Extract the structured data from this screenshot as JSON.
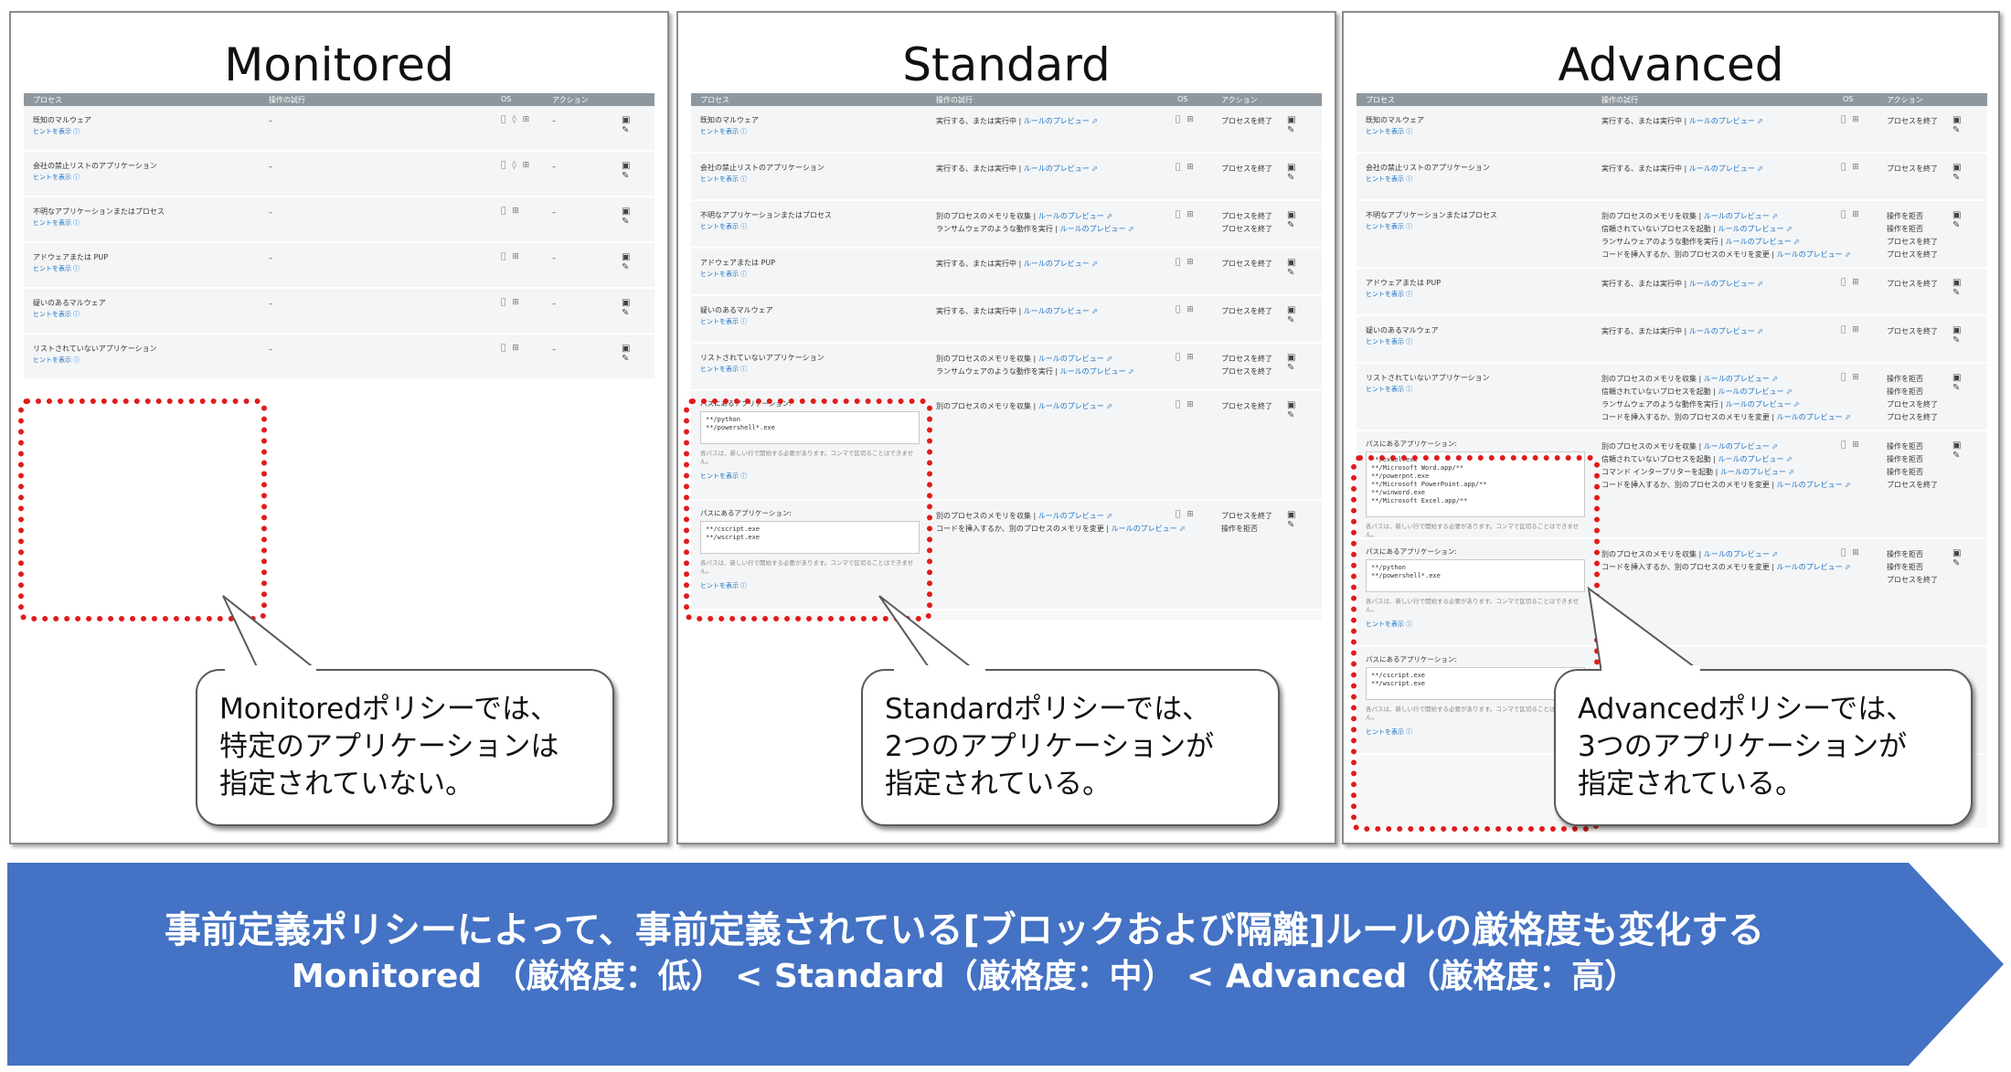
{
  "table_headers": {
    "process": "プロセス",
    "operation": "操作の試行",
    "os": "OS",
    "action": "アクション"
  },
  "hint_label": "ヒントを表示 ⓘ",
  "os_icons": {
    "mac_win_linux": " ◊ ⊞",
    "mac_win": " ⊞"
  },
  "tool_icons": "▣ ✎",
  "rule_preview": "ルールのプレビュー ⬀",
  "monitored": {
    "title": "Monitored",
    "rows": [
      {
        "process": "既知のマルウェア",
        "op": "–",
        "os": "mac_win_linux",
        "act": "–"
      },
      {
        "process": "会社の禁止リストのアプリケーション",
        "op": "–",
        "os": "mac_win_linux",
        "act": "–"
      },
      {
        "process": "不明なアプリケーションまたはプロセス",
        "op": "–",
        "os": "mac_win",
        "act": "–"
      },
      {
        "process": "アドウェアまたは PUP",
        "op": "–",
        "os": "mac_win",
        "act": "–"
      },
      {
        "process": "疑いのあるマルウェア",
        "op": "–",
        "os": "mac_win",
        "act": "–"
      },
      {
        "process": "リストされていないアプリケーション",
        "op": "–",
        "os": "mac_win",
        "act": "–"
      }
    ],
    "callout": [
      "Monitoredポリシーでは、",
      "特定のアプリケーションは",
      "指定されていない。"
    ]
  },
  "standard": {
    "title": "Standard",
    "rows": [
      {
        "process": "既知のマルウェア",
        "ops": [
          "実行する、または実行中"
        ],
        "act": [
          "プロセスを終了"
        ]
      },
      {
        "process": "会社の禁止リストのアプリケーション",
        "ops": [
          "実行する、または実行中"
        ],
        "act": [
          "プロセスを終了"
        ]
      },
      {
        "process": "不明なアプリケーションまたはプロセス",
        "ops": [
          "別のプロセスのメモリを収集",
          "ランサムウェアのような動作を実行"
        ],
        "act": [
          "プロセスを終了",
          "プロセスを終了"
        ]
      },
      {
        "process": "アドウェアまたは PUP",
        "ops": [
          "実行する、または実行中"
        ],
        "act": [
          "プロセスを終了"
        ]
      },
      {
        "process": "疑いのあるマルウェア",
        "ops": [
          "実行する、または実行中"
        ],
        "act": [
          "プロセスを終了"
        ]
      },
      {
        "process": "リストされていないアプリケーション",
        "ops": [
          "別のプロセスのメモリを収集",
          "ランサムウェアのような動作を実行"
        ],
        "act": [
          "プロセスを終了",
          "プロセスを終了"
        ]
      }
    ],
    "app_rows": [
      {
        "label": "パスにあるアプリケーション:",
        "paths": [
          "**/python",
          "**/powershell*.exe"
        ],
        "ops": [
          "別のプロセスのメモリを収集"
        ],
        "act": [
          "プロセスを終了"
        ]
      },
      {
        "label": "パスにあるアプリケーション:",
        "paths": [
          "**/cscript.exe",
          "**/wscript.exe"
        ],
        "ops": [
          "別のプロセスのメモリを収集",
          "コードを挿入するか、別のプロセスのメモリを変更"
        ],
        "act": [
          "プロセスを終了",
          "操作を拒否"
        ]
      }
    ],
    "callout": [
      "Standardポリシーでは、",
      "2つのアプリケーションが",
      "指定されている。"
    ]
  },
  "advanced": {
    "title": "Advanced",
    "rows": [
      {
        "process": "既知のマルウェア",
        "ops": [
          "実行する、または実行中"
        ],
        "act": [
          "プロセスを終了"
        ]
      },
      {
        "process": "会社の禁止リストのアプリケーション",
        "ops": [
          "実行する、または実行中"
        ],
        "act": [
          "プロセスを終了"
        ]
      },
      {
        "process": "不明なアプリケーションまたはプロセス",
        "ops": [
          "別のプロセスのメモリを収集",
          "信頼されていないプロセスを起動",
          "ランサムウェアのような動作を実行",
          "コードを挿入するか、別のプロセスのメモリを変更"
        ],
        "act": [
          "操作を拒否",
          "操作を拒否",
          "プロセスを終了",
          "プロセスを終了"
        ]
      },
      {
        "process": "アドウェアまたは PUP",
        "ops": [
          "実行する、または実行中"
        ],
        "act": [
          "プロセスを終了"
        ]
      },
      {
        "process": "疑いのあるマルウェア",
        "ops": [
          "実行する、または実行中"
        ],
        "act": [
          "プロセスを終了"
        ]
      },
      {
        "process": "リストされていないアプリケーション",
        "ops": [
          "別のプロセスのメモリを収集",
          "信頼されていないプロセスを起動",
          "ランサムウェアのような動作を実行",
          "コードを挿入するか、別のプロセスのメモリを変更"
        ],
        "act": [
          "操作を拒否",
          "操作を拒否",
          "プロセスを終了",
          "プロセスを終了"
        ]
      }
    ],
    "app_rows": [
      {
        "label": "パスにあるアプリケーション:",
        "paths": [
          "**/excel.exe",
          "**/Microsoft Word.app/**",
          "**/powerpnt.exe",
          "**/Microsoft PowerPoint.app/**",
          "**/winword.exe",
          "**/Microsoft Excel.app/**"
        ],
        "ops": [
          "別のプロセスのメモリを収集",
          "信頼されていないプロセスを起動",
          "コマンド インタープリターを起動",
          "コードを挿入するか、別のプロセスのメモリを変更"
        ],
        "act": [
          "操作を拒否",
          "操作を拒否",
          "操作を拒否",
          "プロセスを終了"
        ]
      },
      {
        "label": "パスにあるアプリケーション:",
        "paths": [
          "**/python",
          "**/powershell*.exe"
        ],
        "ops": [
          "別のプロセスのメモリを収集",
          "コードを挿入するか、別のプロセスのメモリを変更"
        ],
        "act": [
          "操作を拒否",
          "操作を拒否",
          "プロセスを終了"
        ]
      },
      {
        "label": "パスにあるアプリケーション:",
        "paths": [
          "**/cscript.exe",
          "**/wscript.exe"
        ],
        "ops": [],
        "act": []
      }
    ],
    "callout": [
      "Advancedポリシーでは、",
      "3つのアプリケーションが",
      "指定されている。"
    ]
  },
  "app_note": "各パスは、新しい行で開始する必要があります。コンマで区切ることはできません。",
  "banner": {
    "line1": "事前定義ポリシーによって、事前定義されている[ブロックおよび隔離]ルールの厳格度も変化する",
    "line2": "Monitored （厳格度：低） < Standard（厳格度：中） < Advanced（厳格度：高）",
    "color": "#4472c4"
  }
}
